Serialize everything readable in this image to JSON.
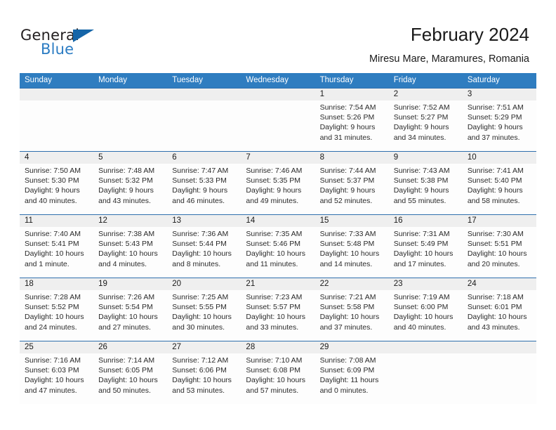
{
  "brand": {
    "name_top": "General",
    "name_bottom": "Blue",
    "accent_color": "#2b7cc3",
    "triangle_color": "#1565a8"
  },
  "header": {
    "title": "February 2024",
    "subtitle": "Miresu Mare, Maramures, Romania",
    "header_bg": "#2f7dc0",
    "row_divider_color": "#2f6fad",
    "daynum_bg": "#efefef"
  },
  "calendar": {
    "weekday_headers": [
      "Sunday",
      "Monday",
      "Tuesday",
      "Wednesday",
      "Thursday",
      "Friday",
      "Saturday"
    ],
    "weeks": [
      [
        {
          "day": "",
          "sunrise": "",
          "sunset": "",
          "daylight1": "",
          "daylight2": ""
        },
        {
          "day": "",
          "sunrise": "",
          "sunset": "",
          "daylight1": "",
          "daylight2": ""
        },
        {
          "day": "",
          "sunrise": "",
          "sunset": "",
          "daylight1": "",
          "daylight2": ""
        },
        {
          "day": "",
          "sunrise": "",
          "sunset": "",
          "daylight1": "",
          "daylight2": ""
        },
        {
          "day": "1",
          "sunrise": "Sunrise: 7:54 AM",
          "sunset": "Sunset: 5:26 PM",
          "daylight1": "Daylight: 9 hours",
          "daylight2": "and 31 minutes."
        },
        {
          "day": "2",
          "sunrise": "Sunrise: 7:52 AM",
          "sunset": "Sunset: 5:27 PM",
          "daylight1": "Daylight: 9 hours",
          "daylight2": "and 34 minutes."
        },
        {
          "day": "3",
          "sunrise": "Sunrise: 7:51 AM",
          "sunset": "Sunset: 5:29 PM",
          "daylight1": "Daylight: 9 hours",
          "daylight2": "and 37 minutes."
        }
      ],
      [
        {
          "day": "4",
          "sunrise": "Sunrise: 7:50 AM",
          "sunset": "Sunset: 5:30 PM",
          "daylight1": "Daylight: 9 hours",
          "daylight2": "and 40 minutes."
        },
        {
          "day": "5",
          "sunrise": "Sunrise: 7:48 AM",
          "sunset": "Sunset: 5:32 PM",
          "daylight1": "Daylight: 9 hours",
          "daylight2": "and 43 minutes."
        },
        {
          "day": "6",
          "sunrise": "Sunrise: 7:47 AM",
          "sunset": "Sunset: 5:33 PM",
          "daylight1": "Daylight: 9 hours",
          "daylight2": "and 46 minutes."
        },
        {
          "day": "7",
          "sunrise": "Sunrise: 7:46 AM",
          "sunset": "Sunset: 5:35 PM",
          "daylight1": "Daylight: 9 hours",
          "daylight2": "and 49 minutes."
        },
        {
          "day": "8",
          "sunrise": "Sunrise: 7:44 AM",
          "sunset": "Sunset: 5:37 PM",
          "daylight1": "Daylight: 9 hours",
          "daylight2": "and 52 minutes."
        },
        {
          "day": "9",
          "sunrise": "Sunrise: 7:43 AM",
          "sunset": "Sunset: 5:38 PM",
          "daylight1": "Daylight: 9 hours",
          "daylight2": "and 55 minutes."
        },
        {
          "day": "10",
          "sunrise": "Sunrise: 7:41 AM",
          "sunset": "Sunset: 5:40 PM",
          "daylight1": "Daylight: 9 hours",
          "daylight2": "and 58 minutes."
        }
      ],
      [
        {
          "day": "11",
          "sunrise": "Sunrise: 7:40 AM",
          "sunset": "Sunset: 5:41 PM",
          "daylight1": "Daylight: 10 hours",
          "daylight2": "and 1 minute."
        },
        {
          "day": "12",
          "sunrise": "Sunrise: 7:38 AM",
          "sunset": "Sunset: 5:43 PM",
          "daylight1": "Daylight: 10 hours",
          "daylight2": "and 4 minutes."
        },
        {
          "day": "13",
          "sunrise": "Sunrise: 7:36 AM",
          "sunset": "Sunset: 5:44 PM",
          "daylight1": "Daylight: 10 hours",
          "daylight2": "and 8 minutes."
        },
        {
          "day": "14",
          "sunrise": "Sunrise: 7:35 AM",
          "sunset": "Sunset: 5:46 PM",
          "daylight1": "Daylight: 10 hours",
          "daylight2": "and 11 minutes."
        },
        {
          "day": "15",
          "sunrise": "Sunrise: 7:33 AM",
          "sunset": "Sunset: 5:48 PM",
          "daylight1": "Daylight: 10 hours",
          "daylight2": "and 14 minutes."
        },
        {
          "day": "16",
          "sunrise": "Sunrise: 7:31 AM",
          "sunset": "Sunset: 5:49 PM",
          "daylight1": "Daylight: 10 hours",
          "daylight2": "and 17 minutes."
        },
        {
          "day": "17",
          "sunrise": "Sunrise: 7:30 AM",
          "sunset": "Sunset: 5:51 PM",
          "daylight1": "Daylight: 10 hours",
          "daylight2": "and 20 minutes."
        }
      ],
      [
        {
          "day": "18",
          "sunrise": "Sunrise: 7:28 AM",
          "sunset": "Sunset: 5:52 PM",
          "daylight1": "Daylight: 10 hours",
          "daylight2": "and 24 minutes."
        },
        {
          "day": "19",
          "sunrise": "Sunrise: 7:26 AM",
          "sunset": "Sunset: 5:54 PM",
          "daylight1": "Daylight: 10 hours",
          "daylight2": "and 27 minutes."
        },
        {
          "day": "20",
          "sunrise": "Sunrise: 7:25 AM",
          "sunset": "Sunset: 5:55 PM",
          "daylight1": "Daylight: 10 hours",
          "daylight2": "and 30 minutes."
        },
        {
          "day": "21",
          "sunrise": "Sunrise: 7:23 AM",
          "sunset": "Sunset: 5:57 PM",
          "daylight1": "Daylight: 10 hours",
          "daylight2": "and 33 minutes."
        },
        {
          "day": "22",
          "sunrise": "Sunrise: 7:21 AM",
          "sunset": "Sunset: 5:58 PM",
          "daylight1": "Daylight: 10 hours",
          "daylight2": "and 37 minutes."
        },
        {
          "day": "23",
          "sunrise": "Sunrise: 7:19 AM",
          "sunset": "Sunset: 6:00 PM",
          "daylight1": "Daylight: 10 hours",
          "daylight2": "and 40 minutes."
        },
        {
          "day": "24",
          "sunrise": "Sunrise: 7:18 AM",
          "sunset": "Sunset: 6:01 PM",
          "daylight1": "Daylight: 10 hours",
          "daylight2": "and 43 minutes."
        }
      ],
      [
        {
          "day": "25",
          "sunrise": "Sunrise: 7:16 AM",
          "sunset": "Sunset: 6:03 PM",
          "daylight1": "Daylight: 10 hours",
          "daylight2": "and 47 minutes."
        },
        {
          "day": "26",
          "sunrise": "Sunrise: 7:14 AM",
          "sunset": "Sunset: 6:05 PM",
          "daylight1": "Daylight: 10 hours",
          "daylight2": "and 50 minutes."
        },
        {
          "day": "27",
          "sunrise": "Sunrise: 7:12 AM",
          "sunset": "Sunset: 6:06 PM",
          "daylight1": "Daylight: 10 hours",
          "daylight2": "and 53 minutes."
        },
        {
          "day": "28",
          "sunrise": "Sunrise: 7:10 AM",
          "sunset": "Sunset: 6:08 PM",
          "daylight1": "Daylight: 10 hours",
          "daylight2": "and 57 minutes."
        },
        {
          "day": "29",
          "sunrise": "Sunrise: 7:08 AM",
          "sunset": "Sunset: 6:09 PM",
          "daylight1": "Daylight: 11 hours",
          "daylight2": "and 0 minutes."
        },
        {
          "day": "",
          "sunrise": "",
          "sunset": "",
          "daylight1": "",
          "daylight2": ""
        },
        {
          "day": "",
          "sunrise": "",
          "sunset": "",
          "daylight1": "",
          "daylight2": ""
        }
      ]
    ]
  }
}
